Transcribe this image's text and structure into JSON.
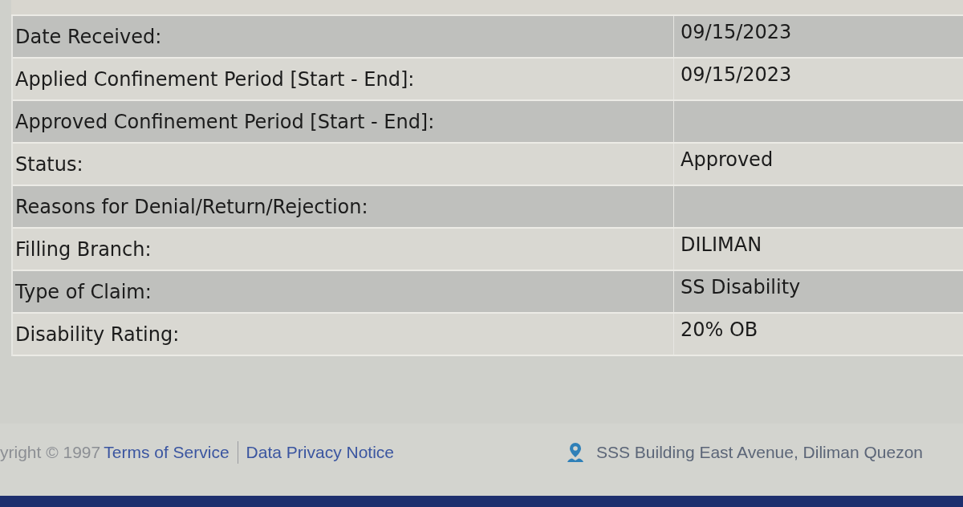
{
  "details": {
    "rows": [
      {
        "label": "Date Received:",
        "value": "09/15/2023"
      },
      {
        "label": "Applied Confinement Period [Start - End]:",
        "value": "09/15/2023"
      },
      {
        "label": "Approved Confinement Period [Start - End]:"
      },
      {
        "label": "Status:",
        "value": "Approved"
      },
      {
        "label": "Reasons for Denial/Return/Rejection:"
      },
      {
        "label": "Filling Branch:",
        "value": "DILIMAN"
      },
      {
        "label": "Type of Claim:",
        "value": "SS Disability"
      },
      {
        "label": "Disability Rating:",
        "value": "20% OB"
      }
    ]
  },
  "footer": {
    "copyright": "yright © 1997",
    "links": [
      "Terms of Service",
      "Data Privacy Notice"
    ],
    "address": "SSS Building East Avenue, Diliman Quezon"
  }
}
